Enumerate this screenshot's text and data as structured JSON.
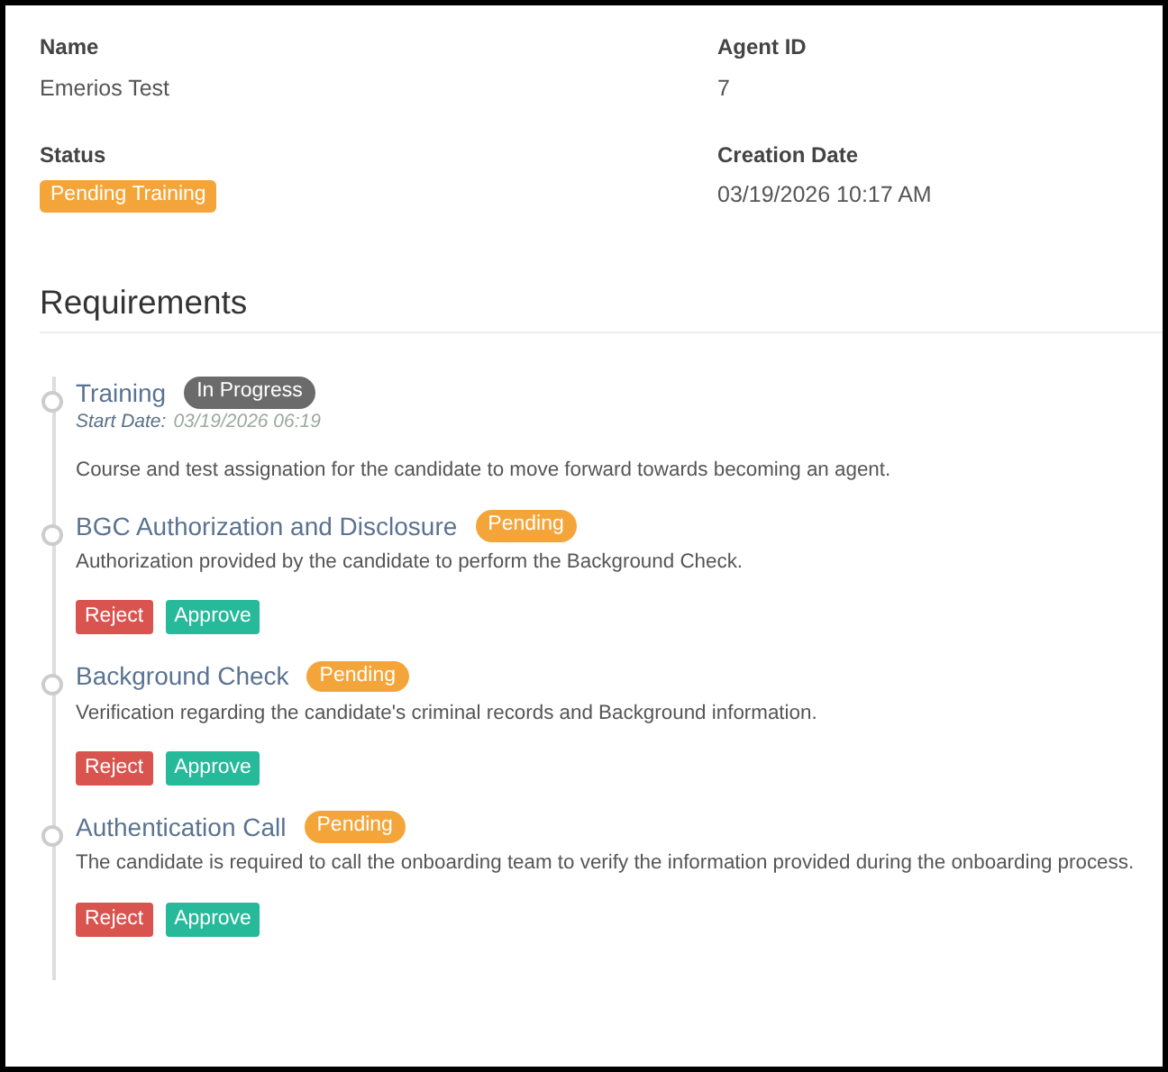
{
  "details": [
    {
      "label": "Name",
      "value": "Emerios Test"
    },
    {
      "label": "Agent ID",
      "value": "7"
    },
    {
      "label": "Status",
      "badge": {
        "text": "Pending Training",
        "kind": "pending"
      }
    },
    {
      "label": "Creation Date",
      "value": "03/19/2026 10:17 AM"
    }
  ],
  "requirements": {
    "title": "Requirements",
    "items": [
      {
        "title": "Training",
        "badge": {
          "text": "In Progress",
          "kind": "in_progress"
        },
        "start_date": {
          "label": "Start Date:",
          "value": "03/19/2026 06:19"
        },
        "description": "Course and test assignation for the candidate to move forward towards becoming an agent."
      },
      {
        "title": "BGC Authorization and Disclosure",
        "badge": {
          "text": "Pending",
          "kind": "pending"
        },
        "description": "Authorization provided by the candidate to perform the Background Check.",
        "buttons": [
          {
            "label": "Reject",
            "kind": "reject"
          },
          {
            "label": "Approve",
            "kind": "approve"
          }
        ]
      },
      {
        "title": "Background Check",
        "badge": {
          "text": "Pending",
          "kind": "pending"
        },
        "description": "Verification regarding the candidate's criminal records and Background information.",
        "buttons": [
          {
            "label": "Reject",
            "kind": "reject"
          },
          {
            "label": "Approve",
            "kind": "approve"
          }
        ]
      },
      {
        "title": "Authentication Call",
        "badge": {
          "text": "Pending",
          "kind": "pending"
        },
        "description": "The candidate is required to call the onboarding team to verify the information provided during the onboarding process.",
        "buttons": [
          {
            "label": "Reject",
            "kind": "reject"
          },
          {
            "label": "Approve",
            "kind": "approve"
          }
        ]
      }
    ]
  }
}
